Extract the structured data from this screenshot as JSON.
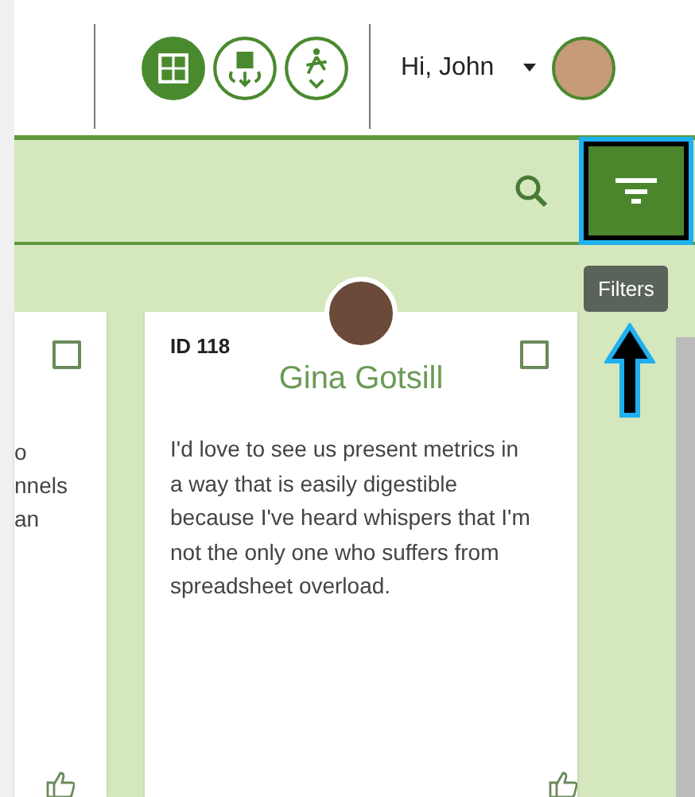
{
  "header": {
    "nav_icons": [
      {
        "selected": true
      },
      {
        "selected": false
      },
      {
        "selected": false
      }
    ],
    "greeting": "Hi, John"
  },
  "toolbar": {
    "filter_button": {
      "selected": true
    },
    "tooltip": "Filters"
  },
  "cards": [
    {
      "kind": "partial",
      "checked": false,
      "lines": [
        "o",
        "nnels",
        "an"
      ]
    },
    {
      "kind": "full",
      "checked": false,
      "id": "ID 118",
      "name": "Gina Gotsill",
      "text": "I'd love to see us present metrics in a way that is easily digestible because I've heard whispers that I'm not the only one who suffers from spreadsheet overload."
    }
  ]
}
